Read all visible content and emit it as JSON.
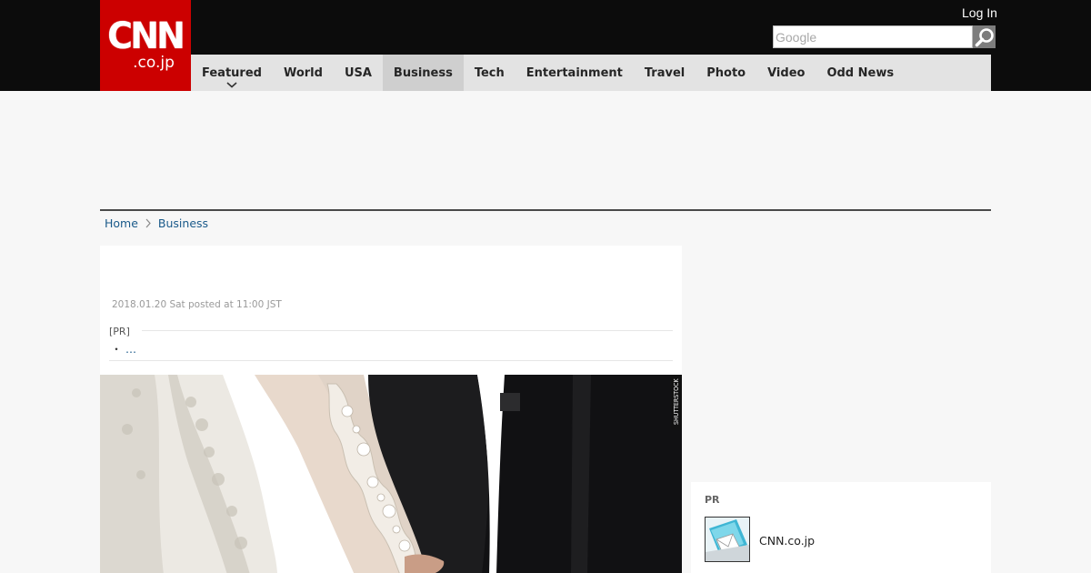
{
  "header": {
    "logo_main": "CNN",
    "logo_sub": ".co.jp",
    "login_label": "Log In",
    "search_placeholder": "Google",
    "nav": [
      {
        "label": "Featured"
      },
      {
        "label": "World"
      },
      {
        "label": "USA"
      },
      {
        "label": "Business"
      },
      {
        "label": "Tech"
      },
      {
        "label": "Entertainment"
      },
      {
        "label": "Travel"
      },
      {
        "label": "Photo"
      },
      {
        "label": "Video"
      },
      {
        "label": "Odd News"
      }
    ],
    "active_nav": "Business"
  },
  "breadcrumb": {
    "home": "Home",
    "current": "Business"
  },
  "article": {
    "posted": "2018.01.20 Sat posted at 11:00 JST",
    "pr_label": "[PR]",
    "pr_bullet": "・",
    "pr_link": "…",
    "photo_credit": "SHUTTERSTOCK"
  },
  "sidebar": {
    "pr_title": "PR",
    "pr_link": "CNN.co.jp"
  },
  "colors": {
    "brand_red": "#cc0000",
    "header_bg": "#0c0c0c",
    "nav_bg": "#e3e3e3",
    "link_blue": "#1a5a8a"
  }
}
